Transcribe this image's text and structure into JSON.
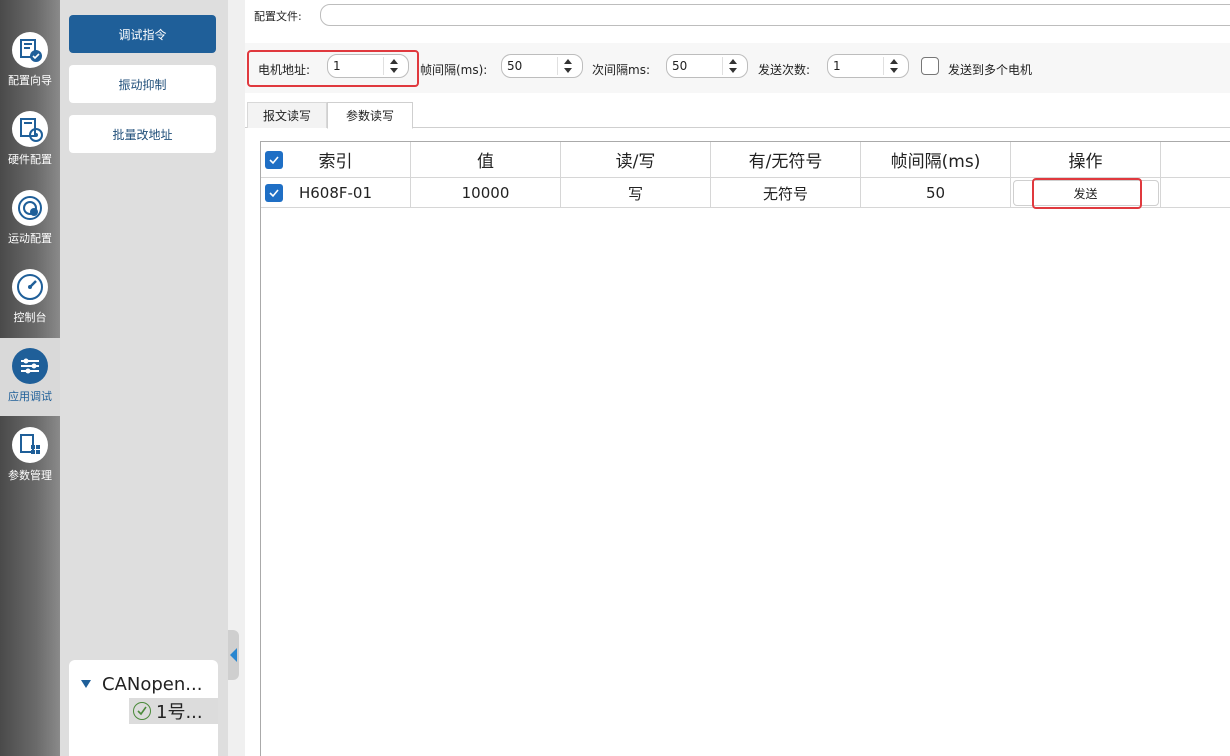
{
  "rail": {
    "items": [
      {
        "label": "配置向导",
        "icon": "config-wizard-icon"
      },
      {
        "label": "硬件配置",
        "icon": "hardware-config-icon"
      },
      {
        "label": "运动配置",
        "icon": "motion-config-icon"
      },
      {
        "label": "控制台",
        "icon": "console-gauge-icon"
      },
      {
        "label": "应用调试",
        "icon": "sliders-icon",
        "active": true
      },
      {
        "label": "参数管理",
        "icon": "param-manage-icon"
      }
    ]
  },
  "submenu": {
    "items": [
      {
        "label": "调试指令",
        "active": true
      },
      {
        "label": "振动抑制"
      },
      {
        "label": "批量改地址"
      }
    ]
  },
  "tree": {
    "root": "CANopen...",
    "child": "1号..."
  },
  "config": {
    "label": "配置文件:",
    "value": ""
  },
  "params": {
    "motor_address": {
      "label": "电机地址:",
      "value": "1"
    },
    "frame_interval": {
      "label": "帧间隔(ms):",
      "value": "50"
    },
    "sub_interval": {
      "label": "次间隔ms:",
      "value": "50"
    },
    "send_count": {
      "label": "发送次数:",
      "value": "1"
    },
    "multi_motor": {
      "label": "发送到多个电机",
      "checked": false
    }
  },
  "tabs": [
    {
      "label": "报文读写",
      "active": false
    },
    {
      "label": "参数读写",
      "active": true
    }
  ],
  "table": {
    "headers": [
      "索引",
      "值",
      "读/写",
      "有/无符号",
      "帧间隔(ms)",
      "操作"
    ],
    "rows": [
      {
        "checked": true,
        "index": "H608F-01",
        "value": "10000",
        "rw": "写",
        "signed": "无符号",
        "interval": "50",
        "action": "发送"
      }
    ]
  },
  "colors": {
    "accent": "#1f5f99",
    "highlight": "#e0393e",
    "checkbox": "#1f6fc5"
  }
}
